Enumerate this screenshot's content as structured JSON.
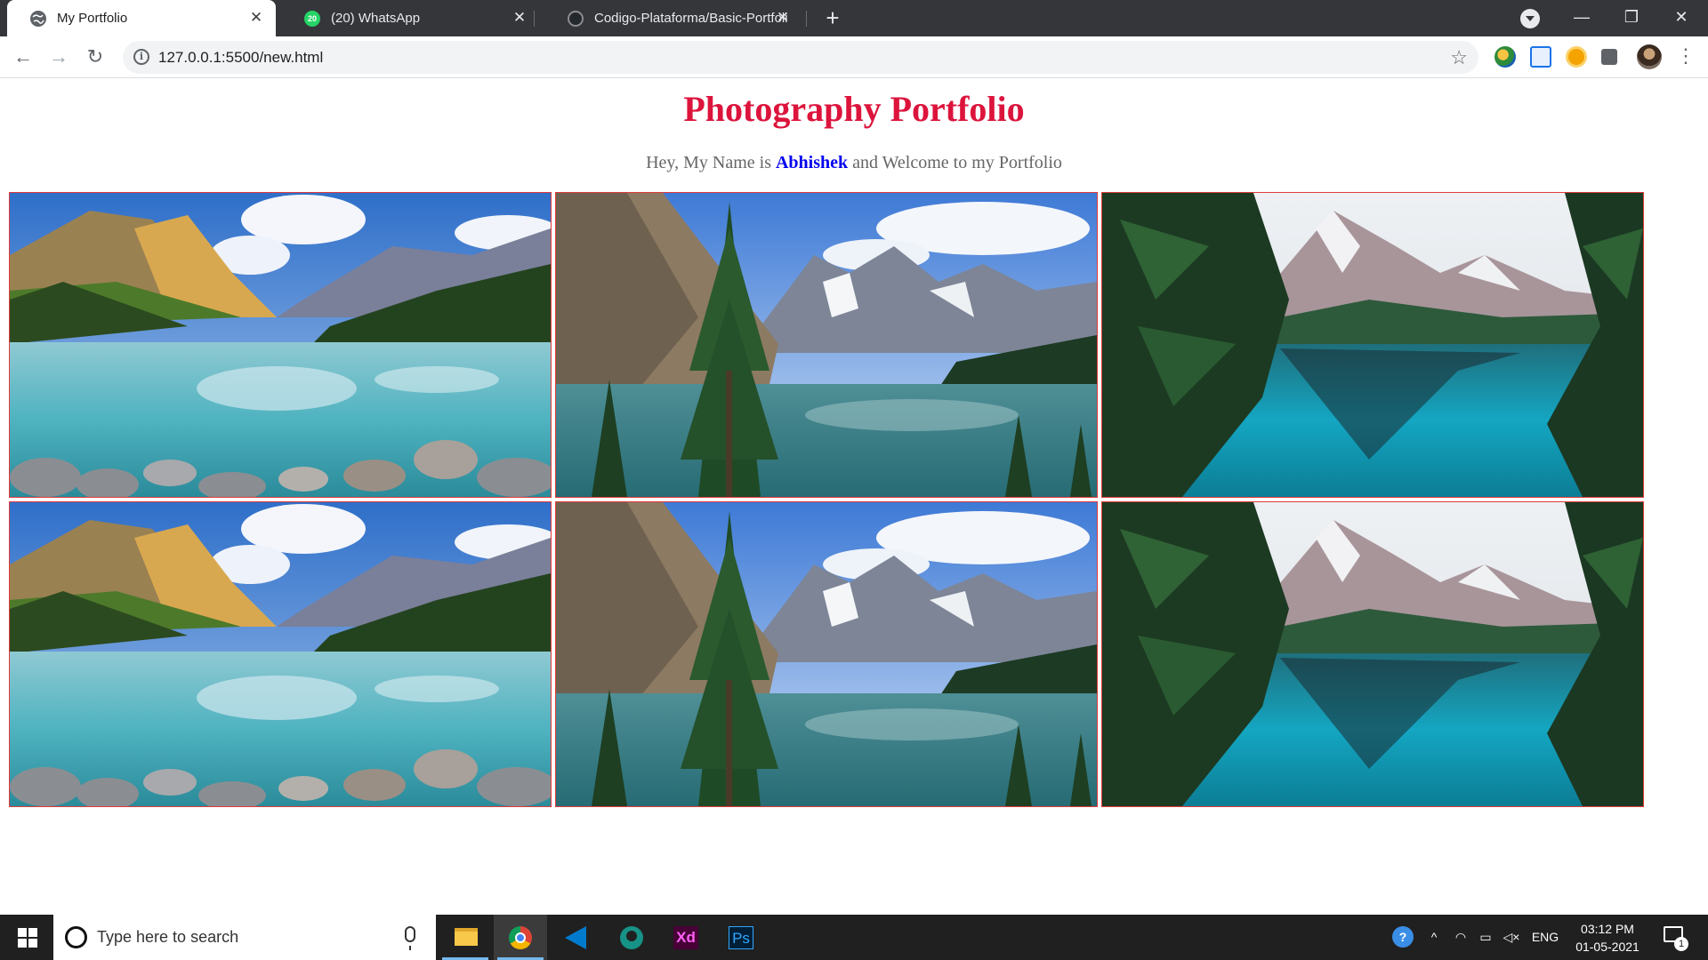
{
  "browser": {
    "tabs": [
      {
        "title": "My Portfolio",
        "favicon": "globe-icon",
        "active": true
      },
      {
        "title": "(20) WhatsApp",
        "favicon": "whatsapp-icon",
        "badge": "20",
        "active": false
      },
      {
        "title": "Codigo-Plataforma/Basic-Portfoli",
        "favicon": "github-icon",
        "active": false
      }
    ],
    "url": "127.0.0.1:5500/new.html",
    "extensions": [
      "vpn-extension-icon",
      "tab-manager-extension-icon",
      "coin-extension-icon",
      "puzzle-extensions-icon",
      "profile-avatar"
    ]
  },
  "page": {
    "title": "Photography Portfolio",
    "intro_before": "Hey, My Name is ",
    "name": "Abhishek",
    "intro_after": " and Welcome to my Portfolio",
    "photos": [
      {
        "scene": "lake-rocks",
        "alt": "Mountain lake with rocky shore"
      },
      {
        "scene": "pine-valley",
        "alt": "Pine trees by a glacial lake"
      },
      {
        "scene": "alpine-lake",
        "alt": "Alpine lake framed by trees"
      },
      {
        "scene": "lake-rocks",
        "alt": "Mountain lake with rocky shore"
      },
      {
        "scene": "pine-valley",
        "alt": "Pine trees by a glacial lake"
      },
      {
        "scene": "alpine-lake",
        "alt": "Alpine lake framed by trees"
      }
    ]
  },
  "taskbar": {
    "search_placeholder": "Type here to search",
    "apps": [
      "file-explorer-icon",
      "chrome-icon",
      "vscode-icon",
      "gitkraken-icon",
      "adobe-xd-icon",
      "photoshop-icon"
    ],
    "xd_label": "Xd",
    "ps_label": "Ps",
    "language": "ENG",
    "time": "03:12 PM",
    "date": "01-05-2021",
    "notification_count": "1"
  },
  "colors": {
    "title": "#dc143c",
    "name_link": "#0000ee",
    "photo_border": "#e23a3a",
    "tab_strip": "#35363a"
  }
}
